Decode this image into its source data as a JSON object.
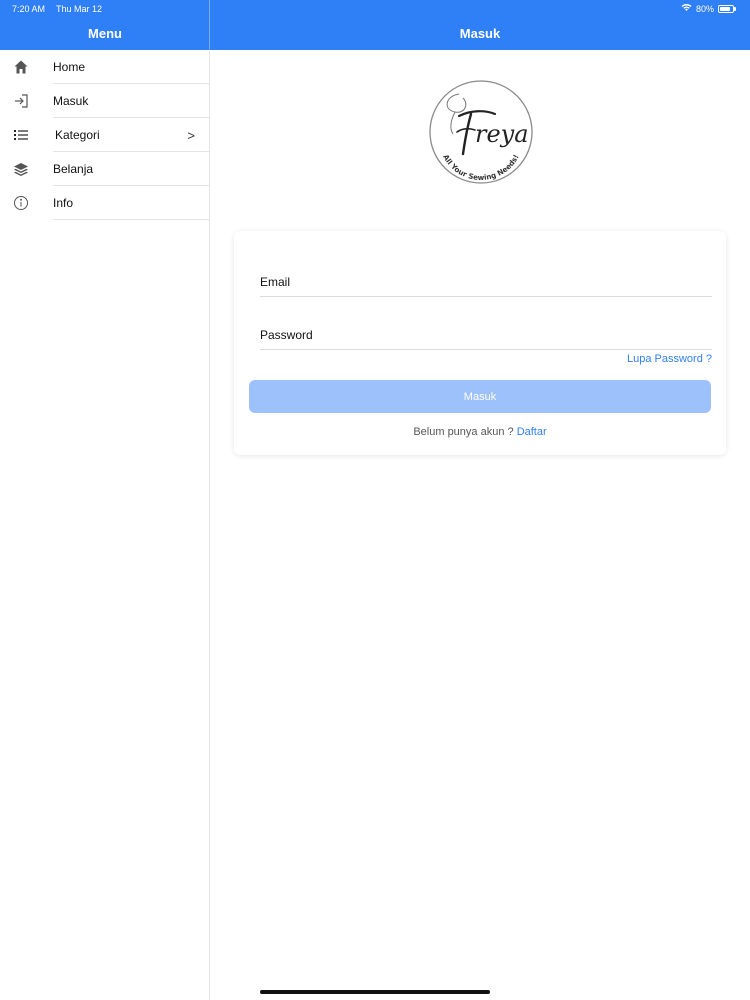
{
  "status_bar": {
    "time": "7:20 AM",
    "date": "Thu Mar 12",
    "battery": "80%",
    "battery_level": 0.8
  },
  "sidebar": {
    "title": "Menu",
    "items": [
      {
        "label": "Home",
        "icon": "home-icon"
      },
      {
        "label": "Masuk",
        "icon": "login-icon"
      },
      {
        "label": "Kategori",
        "icon": "list-icon",
        "chevron": ">"
      },
      {
        "label": "Belanja",
        "icon": "layers-icon"
      },
      {
        "label": "Info",
        "icon": "info-icon"
      }
    ]
  },
  "header": {
    "title": "Masuk"
  },
  "logo": {
    "brand": "Freya",
    "tagline": "All Your Sewing Needs!"
  },
  "form": {
    "email_placeholder": "Email",
    "password_placeholder": "Password",
    "email_value": "",
    "password_value": "",
    "forgot_label": "Lupa Password ?",
    "submit_label": "Masuk",
    "register_prompt": "Belum punya akun ?",
    "register_link": "Daftar"
  },
  "colors": {
    "accent": "#2f7ff7",
    "button_disabled": "#9dc1fb"
  }
}
